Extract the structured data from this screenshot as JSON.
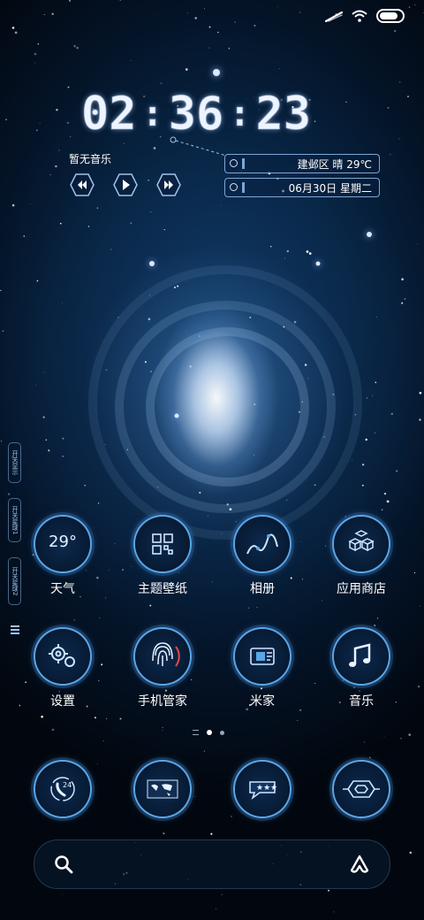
{
  "status_bar": {
    "signal_icon": "signal-icon",
    "wifi_icon": "wifi-icon",
    "battery_icon": "battery-icon",
    "battery_level": 1.0
  },
  "clock": {
    "h": "02",
    "m": "36",
    "s": "23",
    "sep": ":"
  },
  "music": {
    "title": "暂无音乐",
    "prev_icon": "rewind-icon",
    "play_icon": "play-icon",
    "next_icon": "fast-forward-icon"
  },
  "info": {
    "weather": "建邺区 晴 29℃",
    "date": "06月30日  星期二"
  },
  "edge_tabs": [
    "开关显示",
    "开关星球1",
    "开关星球2"
  ],
  "apps": [
    {
      "label": "天气",
      "icon": "weather-icon",
      "text": "29°"
    },
    {
      "label": "主题壁纸",
      "icon": "theme-icon"
    },
    {
      "label": "相册",
      "icon": "gallery-icon"
    },
    {
      "label": "应用商店",
      "icon": "app-store-icon"
    },
    {
      "label": "设置",
      "icon": "settings-gear-icon"
    },
    {
      "label": "手机管家",
      "icon": "fingerprint-icon"
    },
    {
      "label": "米家",
      "icon": "mi-home-icon"
    },
    {
      "label": "音乐",
      "icon": "music-note-icon"
    }
  ],
  "dock": [
    {
      "icon": "phone-icon",
      "text": "24"
    },
    {
      "icon": "world-map-icon"
    },
    {
      "icon": "message-icon"
    },
    {
      "icon": "browser-icon"
    }
  ],
  "page_indicator": {
    "count": 3,
    "current": 2
  },
  "search_bar": {
    "search_icon": "search-icon",
    "assistant_icon": "assistant-icon"
  },
  "colors": {
    "accent": "#5aa6e6",
    "frame": "#7ea6d6",
    "bg_deep": "#03070f"
  }
}
